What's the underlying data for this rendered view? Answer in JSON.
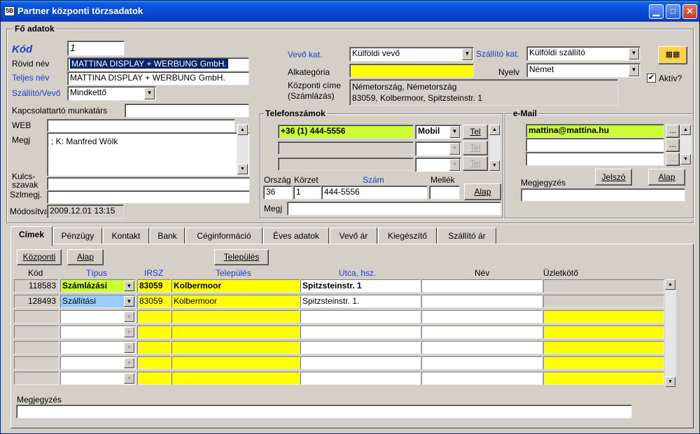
{
  "window": {
    "title": "Partner központi törzsadatok",
    "icon_text": "SB"
  },
  "main_group": {
    "legend": "Fő adatok",
    "kod_label": "Kód",
    "kod_value": "1",
    "rovid_label": "Rövid név",
    "rovid_value": "MATTINA DISPLAY + WERBUNG GmbH.",
    "teljes_label": "Teljes név",
    "teljes_value": "MATTINA DISPLAY + WERBUNG GmbH.",
    "szallito_vevo_label": "Szállító/Vevő",
    "szallito_vevo_value": "Mindkettő",
    "kapcsolattarto_label": "Kapcsolattartó munkatárs",
    "kapcsolattarto_value": "",
    "web_label": "WEB",
    "web_value": "",
    "megj_label": "Megj",
    "megj_value": "; K: Manfred Wölk",
    "kulcs_label1": "Kulcs-",
    "kulcs_label2": "szavak",
    "kulcs_value": "",
    "szlmegj_label": "Szlmegj.",
    "szlmegj_value": "",
    "modositva_label": "Módosítva",
    "modositva_value": "2009.12.01 13:15",
    "vevo_kat_label": "Vevő kat.",
    "vevo_kat_value": "Külföldi vevő",
    "szallito_kat_label": "Szállító kat.",
    "szallito_kat_value": "Külföldi szállító",
    "alkategoria_label": "Alkategória",
    "alkategoria_value": "",
    "nyelv_label": "Nyelv",
    "nyelv_value": "Német",
    "kozponti_label1": "Központi címe",
    "kozponti_label2": "(Számlázás)",
    "kozponti_line1": "Németország, Németország",
    "kozponti_line2": "83059, Kolbermoor, Spitzsteinstr. 1",
    "aktiv_label": "Aktív?",
    "aktiv_check": "✔"
  },
  "phones": {
    "legend": "Telefonszámok",
    "rows": [
      {
        "number": "+36 (1) 444-5556",
        "type": "Mobil",
        "button": "Tel"
      },
      {
        "number": "",
        "type": "",
        "button": "Tel"
      },
      {
        "number": "",
        "type": "",
        "button": "Tel"
      }
    ],
    "orszag_label": "Ország",
    "korzet_label": "Körzet",
    "szam_label": "Szám",
    "mellek_label": "Mellék",
    "orszag_value": "36",
    "korzet_value": "1",
    "szam_value": "444-5556",
    "mellek_value": "",
    "alap_button": "Alap",
    "megj_label": "Megj",
    "megj_value": ""
  },
  "email": {
    "legend": "e-Mail",
    "rows": [
      "mattina@mattina.hu",
      "",
      ""
    ],
    "dots": "...",
    "jelszo_button": "Jelszó",
    "alap_button": "Alap",
    "megjegyzes_label": "Megjegyzés",
    "megjegyzes_value": ""
  },
  "tabs": [
    "Címek",
    "Pénzügy",
    "Kontakt",
    "Bank",
    "Céginformáció",
    "Éves adatok",
    "Vevő ár",
    "Kiegészítő",
    "Szállító ár"
  ],
  "addresses": {
    "buttons": {
      "kozponti": "Központi",
      "alap": "Alap",
      "telepules": "Település"
    },
    "headers": {
      "kod": "Kód",
      "tipus": "Típus",
      "irsz": "IRSZ",
      "telepules": "Település",
      "utca": "Utca, hsz.",
      "nev": "Név",
      "uzletkoto": "Üzletkötő"
    },
    "rows": [
      {
        "kod": "118583",
        "tipus": "Számlázási",
        "irsz": "83059",
        "telepules": "Kolbermoor",
        "utca": "Spitzsteinstr. 1",
        "nev": "",
        "uzletkoto": ""
      },
      {
        "kod": "128493",
        "tipus": "Szállítási",
        "irsz": "83059",
        "telepules": "Kolbermoor",
        "utca": "Spitzsteinstr. 1.",
        "nev": "",
        "uzletkoto": ""
      },
      {
        "kod": "",
        "tipus": "",
        "irsz": "",
        "telepules": "",
        "utca": "",
        "nev": "",
        "uzletkoto": ""
      },
      {
        "kod": "",
        "tipus": "",
        "irsz": "",
        "telepules": "",
        "utca": "",
        "nev": "",
        "uzletkoto": ""
      },
      {
        "kod": "",
        "tipus": "",
        "irsz": "",
        "telepules": "",
        "utca": "",
        "nev": "",
        "uzletkoto": ""
      },
      {
        "kod": "",
        "tipus": "",
        "irsz": "",
        "telepules": "",
        "utca": "",
        "nev": "",
        "uzletkoto": ""
      },
      {
        "kod": "",
        "tipus": "",
        "irsz": "",
        "telepules": "",
        "utca": "",
        "nev": "",
        "uzletkoto": ""
      }
    ],
    "megjegyzes_label": "Megjegyzés",
    "megjegyzes_value": ""
  },
  "colors": {
    "title_blue": "#0848d0",
    "label_blue": "#1a3cd4",
    "yellow": "#ffff00",
    "green": "#ccff33",
    "light_blue": "#99ccff"
  }
}
